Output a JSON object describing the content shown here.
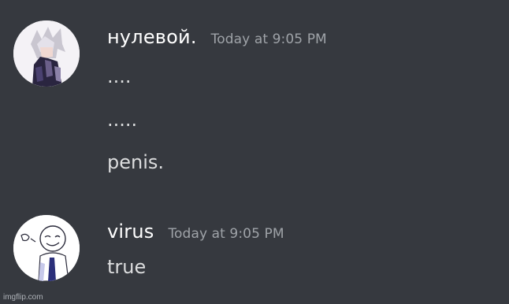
{
  "colors": {
    "background": "#36393f",
    "username": "#ffffff",
    "timestamp": "#9fa3a8",
    "message_text": "#dcddde"
  },
  "messages": [
    {
      "author": "нулевой.",
      "timestamp": "Today at 9:05 PM",
      "avatar_icon": "anime-character-avatar-icon",
      "lines": [
        "....",
        ".....",
        "penis."
      ]
    },
    {
      "author": "virus",
      "timestamp": "Today at 9:05 PM",
      "avatar_icon": "sketch-character-avatar-icon",
      "lines": [
        "true"
      ]
    }
  ],
  "watermark": "imgflip.com"
}
